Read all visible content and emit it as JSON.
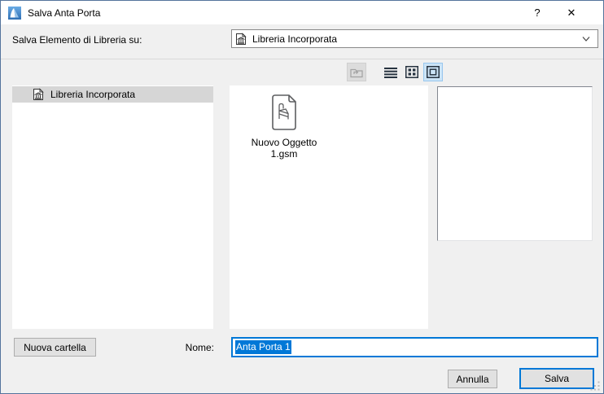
{
  "window": {
    "title": "Salva Anta Porta",
    "help_label": "?",
    "close_label": "✕"
  },
  "header": {
    "label": "Salva Elemento di Libreria su:",
    "combo_value": "Libreria Incorporata",
    "combo_icon": "embedded-library-icon",
    "chevron_icon": "chevron-down-icon"
  },
  "toolbar": {
    "buttons": [
      {
        "name": "folder-up-view-button",
        "icon": "folder-up-icon",
        "state": "disabled"
      },
      {
        "name": "list-view-button",
        "icon": "list-view-icon",
        "state": "normal"
      },
      {
        "name": "small-icons-view-button",
        "icon": "small-icons-view-icon",
        "state": "normal"
      },
      {
        "name": "large-icon-view-button",
        "icon": "large-icon-view-icon",
        "state": "selected"
      }
    ]
  },
  "sidebar": {
    "items": [
      {
        "label": "Libreria Incorporata",
        "icon": "embedded-library-icon",
        "selected": true
      }
    ]
  },
  "files": {
    "items": [
      {
        "name_line1": "Nuovo Oggetto",
        "name_line2": "1.gsm",
        "icon": "gsm-object-file-icon"
      }
    ]
  },
  "preview": {
    "content": ""
  },
  "footer": {
    "new_folder_label": "Nuova cartella",
    "name_label": "Nome:",
    "name_value": "Anta Porta 1",
    "name_value_selected": true
  },
  "actions": {
    "cancel_label": "Annulla",
    "save_label": "Salva"
  },
  "colors": {
    "accent": "#0078d7",
    "selection_bg": "#0078d7",
    "selected_view_bg": "#cce4f7",
    "selected_view_border": "#98c7ee",
    "tree_selected_bg": "#d6d6d6",
    "titlebar_bg": "#ffffff",
    "dialog_bg": "#f0f0f0",
    "dialog_border": "#54749c"
  }
}
